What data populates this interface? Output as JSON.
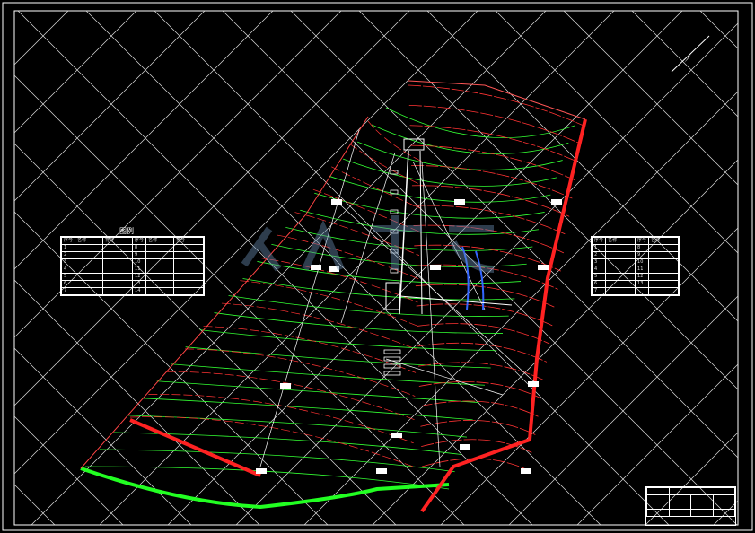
{
  "drawing": {
    "title": "",
    "legend_left_heading": "图例",
    "legend_left_headers": [
      "序号",
      "名称",
      "符号",
      "序号",
      "名称",
      "符号"
    ],
    "legend_left_numbers": [
      "1",
      "2",
      "3",
      "4",
      "5",
      "6",
      "7",
      "8",
      "9",
      "10",
      "11",
      "12",
      "13",
      "14"
    ],
    "legend_right_headers": [
      "序号",
      "名称",
      "序号",
      "名称"
    ],
    "legend_right_numbers": [
      "1",
      "2",
      "3",
      "4",
      "5",
      "6",
      "7",
      "8",
      "9",
      "10",
      "11",
      "12",
      "13"
    ],
    "title_block": {
      "unit_label": "",
      "drawing_title": "",
      "scale": ""
    }
  }
}
